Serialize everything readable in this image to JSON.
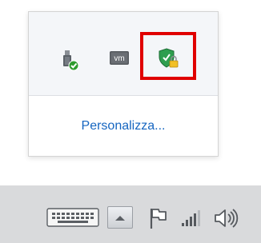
{
  "flyout": {
    "icons": [
      "usb-device-check-icon",
      "vmware-tools-icon",
      "security-shield-lock-icon"
    ],
    "vm_label": "vm",
    "customize_link": "Personalizza..."
  },
  "taskbar": {
    "items": [
      "touch-keyboard-icon",
      "show-hidden-icons-button",
      "action-center-flag-icon",
      "network-signal-icon",
      "volume-icon"
    ]
  },
  "colors": {
    "highlight": "#e00000",
    "link": "#1565c0",
    "taskbar": "#d9dadc"
  }
}
